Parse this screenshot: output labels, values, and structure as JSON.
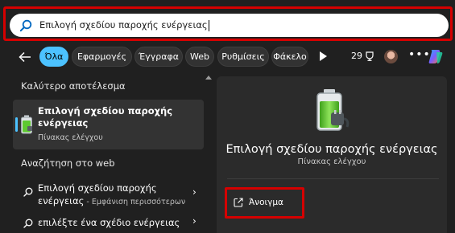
{
  "search": {
    "query": "Επιλογή σχεδίου παροχής ενέργειας"
  },
  "filters": {
    "items": [
      "Όλα",
      "Εφαρμογές",
      "Έγγραφα",
      "Web",
      "Ρυθμίσεις",
      "Φάκελο"
    ],
    "active": "Όλα",
    "points": "29"
  },
  "colors": {
    "accent": "#4cc2ff",
    "highlight": "#d60000",
    "background": "#202020",
    "panel": "#2b2b2b"
  },
  "results": {
    "best_heading": "Καλύτερο αποτέλεσμα",
    "best": {
      "title": "Επιλογή σχεδίου παροχής ενέργειας",
      "subtitle": "Πίνακας ελέγχου",
      "icon": "battery-power-icon"
    },
    "web_heading": "Αναζήτηση στο web",
    "web_items": [
      {
        "line1": "Επιλογή σχεδίου παροχής",
        "line2": "ενέργειας",
        "extra": " - Εμφάνιση περισσότερων"
      },
      {
        "line1": "επιλέξτε ένα σχέδιο ενέργειας"
      }
    ]
  },
  "detail": {
    "title": "Επιλογή σχεδίου παροχής ενέργειας",
    "subtitle": "Πίνακας ελέγχου",
    "action_label": "Άνοιγμα",
    "action_icon": "open-external-icon"
  }
}
